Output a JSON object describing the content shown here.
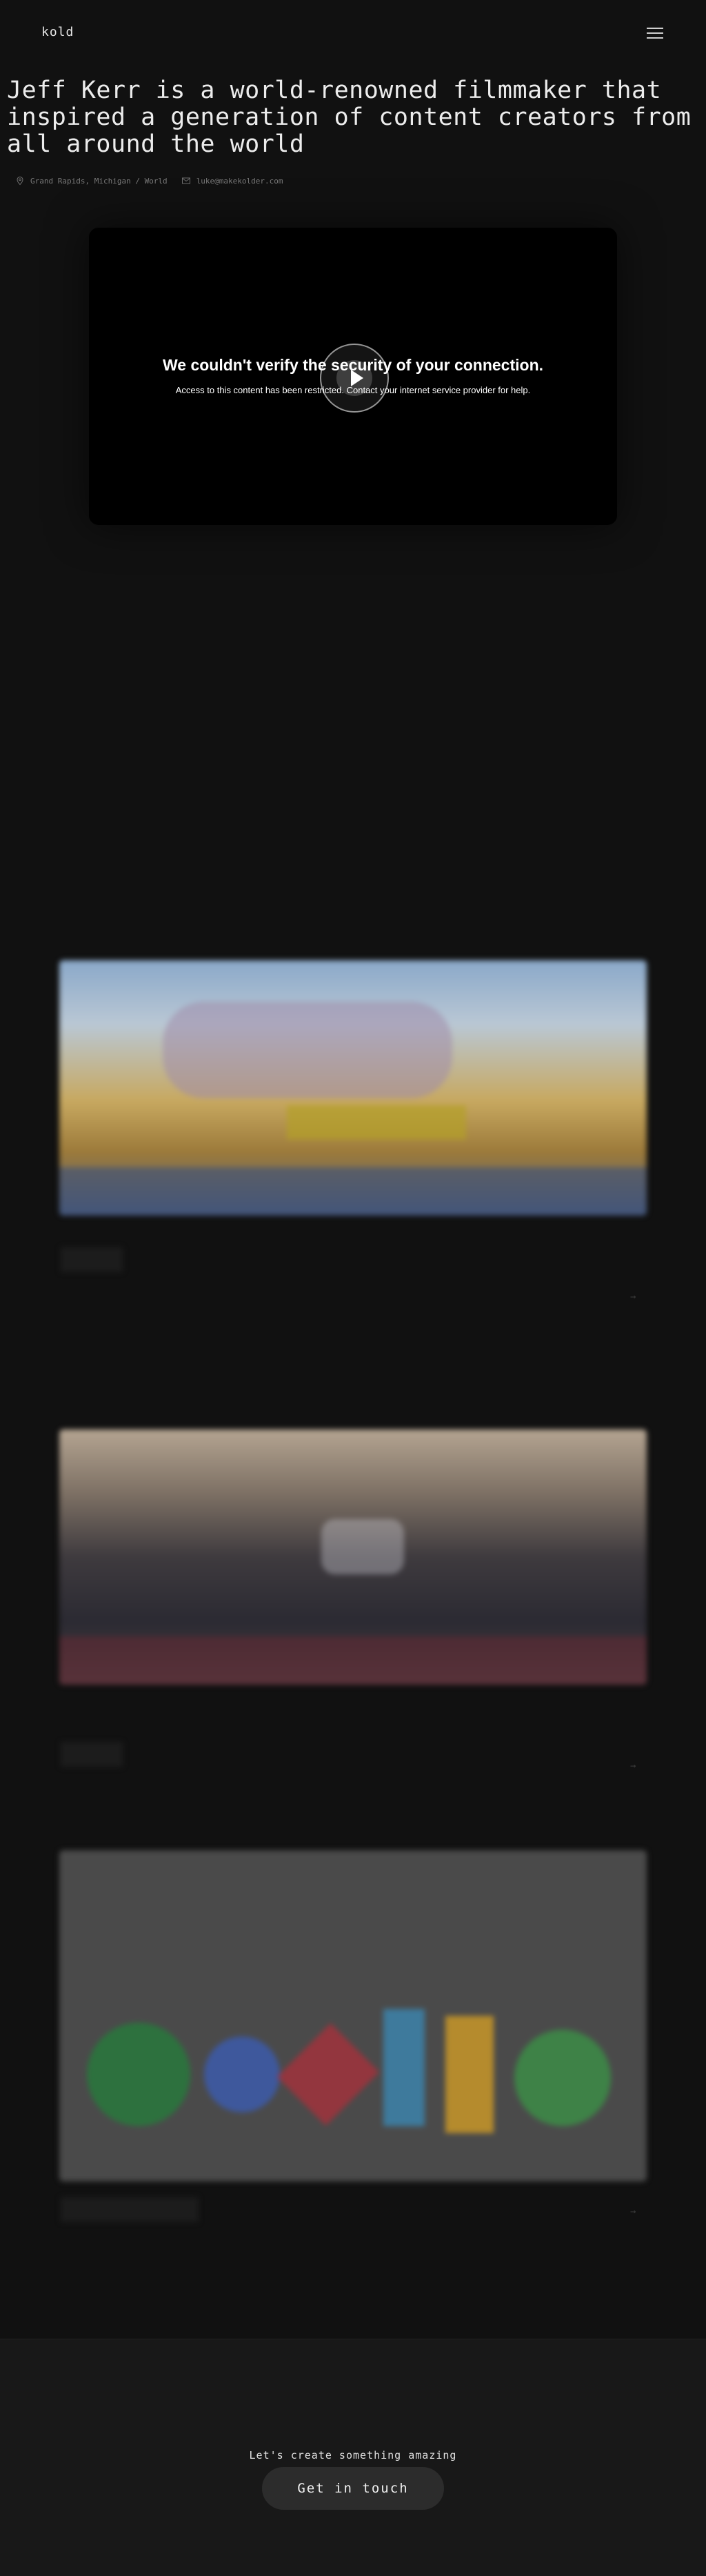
{
  "header": {
    "logo": "kold",
    "menu_icon": "hamburger-menu-icon"
  },
  "hero": {
    "headline": "Jeff Kerr is a world-renowned filmmaker that inspired a generation of content creators from all around the world",
    "location": "Grand Rapids, Michigan / World",
    "email": "luke@makekolder.com",
    "location_icon": "map-pin-icon",
    "email_icon": "mail-icon"
  },
  "video": {
    "error_title": "We couldn't verify the security of your connection.",
    "error_message": "Access to this content has been restricted. Contact your internet service provider for help.",
    "play_icon": "play-icon"
  },
  "projects": [
    {
      "thumbnail": "Oshkosh 21 banner artwork",
      "title": "",
      "arrow_icon": "arrow-right-icon"
    },
    {
      "thumbnail": "mountain town landscape",
      "title": "",
      "arrow_icon": "arrow-right-icon"
    },
    {
      "thumbnail": "colorful lettering on gray",
      "title": "",
      "arrow_icon": "arrow-right-icon"
    }
  ],
  "footer": {
    "cta_text": "Let's create something amazing",
    "cta_button": "Get in touch"
  },
  "colors": {
    "background": "#111111",
    "footer": "#181818",
    "button": "#2c2c2c",
    "text": "#ececec"
  }
}
